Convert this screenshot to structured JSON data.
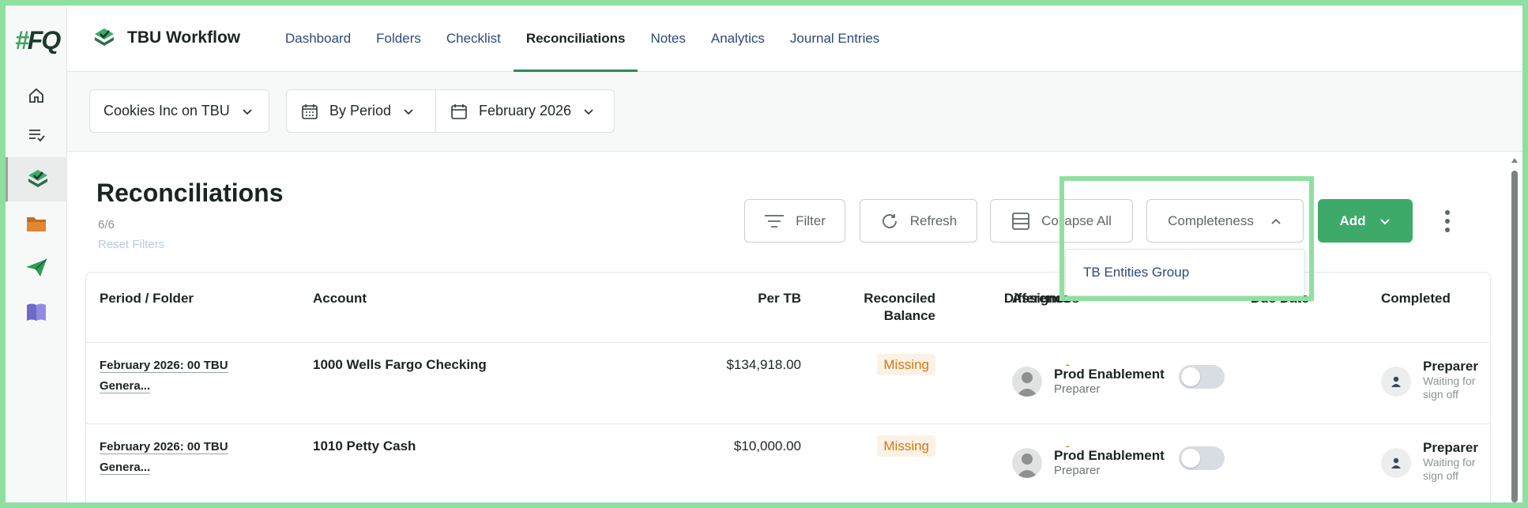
{
  "app": {
    "logo_text": "#FQ",
    "title": "TBU Workflow"
  },
  "nav": {
    "tabs": [
      {
        "label": "Dashboard"
      },
      {
        "label": "Folders"
      },
      {
        "label": "Checklist"
      },
      {
        "label": "Reconciliations",
        "active": true
      },
      {
        "label": "Notes"
      },
      {
        "label": "Analytics"
      },
      {
        "label": "Journal Entries"
      }
    ]
  },
  "selectors": {
    "company": "Cookies Inc on TBU",
    "mode": "By Period",
    "period": "February 2026"
  },
  "page": {
    "title": "Reconciliations",
    "count": "6/6",
    "reset_filters": "Reset Filters"
  },
  "toolbar": {
    "filter": "Filter",
    "refresh": "Refresh",
    "collapse_all": "Collapse All",
    "completeness": "Completeness",
    "add": "Add"
  },
  "dropdown": {
    "options": [
      "TB Entities Group"
    ]
  },
  "table": {
    "headers": {
      "period": "Period / Folder",
      "account": "Account",
      "per_tb": "Per TB",
      "reconciled_1": "Reconciled",
      "reconciled_2": "Balance",
      "difference": "Difference",
      "assignees": "Assignees",
      "due_date": "Due Date",
      "completed": "Completed"
    },
    "rows": [
      {
        "period_1": "February 2026: 00 TBU",
        "period_2": "Genera...",
        "account": "1000 Wells Fargo Checking",
        "per_tb": "$134,918.00",
        "reconciled": "Missing",
        "difference": "-",
        "assignee_name": "Prod Enablement",
        "assignee_role": "Preparer",
        "completed_title": "Preparer",
        "completed_sub": "Waiting for sign off"
      },
      {
        "period_1": "February 2026: 00 TBU",
        "period_2": "Genera...",
        "account": "1010 Petty Cash",
        "per_tb": "$10,000.00",
        "reconciled": "Missing",
        "difference": "-",
        "assignee_name": "Prod Enablement",
        "assignee_role": "Preparer",
        "completed_title": "Preparer",
        "completed_sub": "Waiting for sign off"
      }
    ]
  },
  "colors": {
    "accent": "#3daa6a",
    "highlight": "#8fe0a0",
    "missing": "#d07a18"
  }
}
